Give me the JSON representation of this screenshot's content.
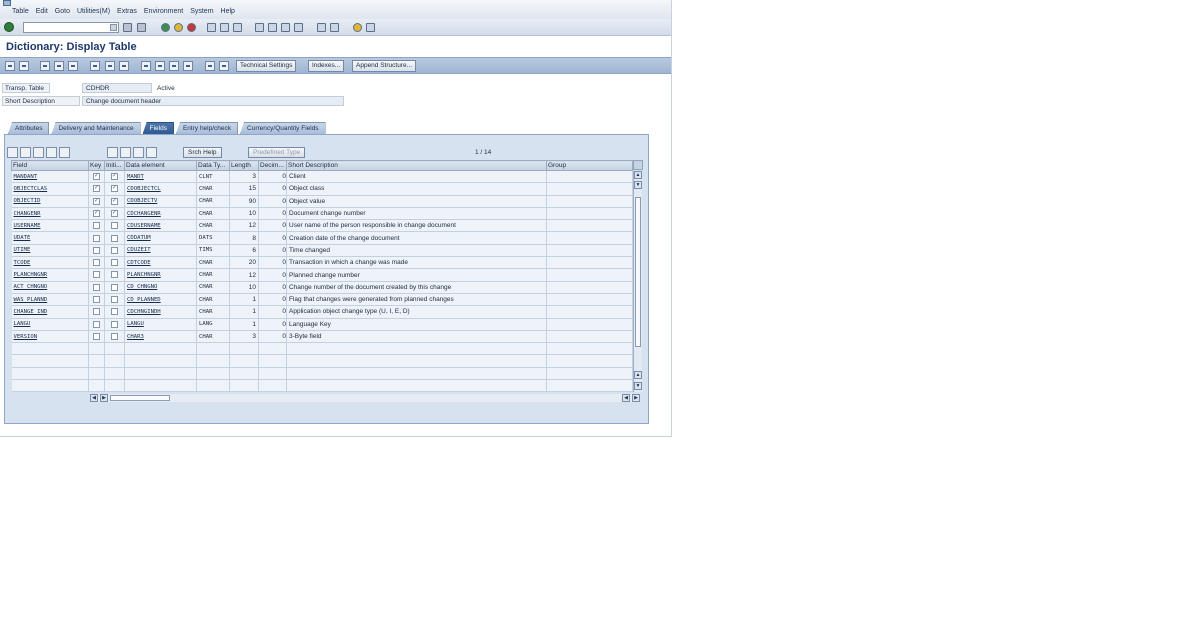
{
  "menu": {
    "items": [
      "Table",
      "Edit",
      "Goto",
      "Utilities(M)",
      "Extras",
      "Environment",
      "System",
      "Help"
    ]
  },
  "system_toolbar": {
    "command_field": ""
  },
  "title": "Dictionary: Display Table",
  "app_toolbar": {
    "technical_settings": "Technical Settings",
    "indexes": "Indexes...",
    "append_structure": "Append Structure..."
  },
  "header": {
    "table_label": "Transp. Table",
    "table_value": "CDHDR",
    "status": "Active",
    "short_desc_label": "Short Description",
    "short_desc_value": "Change document header"
  },
  "tabs": [
    {
      "label": "Attributes",
      "active": false
    },
    {
      "label": "Delivery and Maintenance",
      "active": false
    },
    {
      "label": "Fields",
      "active": true
    },
    {
      "label": "Entry help/check",
      "active": false
    },
    {
      "label": "Currency/Quantity Fields",
      "active": false
    }
  ],
  "panel_toolbar": {
    "srch_help": "Srch Help",
    "predefined_type": "Predefined Type",
    "pager": "1 / 14"
  },
  "columns": [
    "Field",
    "Key",
    "Initi...",
    "Data element",
    "Data Ty...",
    "Length",
    "Decim...",
    "Short Description",
    "Group"
  ],
  "rows": [
    {
      "field": "MANDANT",
      "key": true,
      "init": true,
      "data_element": "MANDT",
      "type": "CLNT",
      "length": "3",
      "dec": "0",
      "desc": "Client"
    },
    {
      "field": "OBJECTCLAS",
      "key": true,
      "init": true,
      "data_element": "CDOBJECTCL",
      "type": "CHAR",
      "length": "15",
      "dec": "0",
      "desc": "Object class"
    },
    {
      "field": "OBJECTID",
      "key": true,
      "init": true,
      "data_element": "CDOBJECTV",
      "type": "CHAR",
      "length": "90",
      "dec": "0",
      "desc": "Object value"
    },
    {
      "field": "CHANGENR",
      "key": true,
      "init": true,
      "data_element": "CDCHANGENR",
      "type": "CHAR",
      "length": "10",
      "dec": "0",
      "desc": "Document change number"
    },
    {
      "field": "USERNAME",
      "key": false,
      "init": false,
      "data_element": "CDUSERNAME",
      "type": "CHAR",
      "length": "12",
      "dec": "0",
      "desc": "User name of the person responsible in change document"
    },
    {
      "field": "UDATE",
      "key": false,
      "init": false,
      "data_element": "CDDATUM",
      "type": "DATS",
      "length": "8",
      "dec": "0",
      "desc": "Creation date of the change document"
    },
    {
      "field": "UTIME",
      "key": false,
      "init": false,
      "data_element": "CDUZEIT",
      "type": "TIMS",
      "length": "6",
      "dec": "0",
      "desc": "Time changed"
    },
    {
      "field": "TCODE",
      "key": false,
      "init": false,
      "data_element": "CDTCODE",
      "type": "CHAR",
      "length": "20",
      "dec": "0",
      "desc": "Transaction in which a change was made"
    },
    {
      "field": "PLANCHNGNR",
      "key": false,
      "init": false,
      "data_element": "PLANCHNGNR",
      "type": "CHAR",
      "length": "12",
      "dec": "0",
      "desc": "Planned change number"
    },
    {
      "field": "ACT_CHNGNO",
      "key": false,
      "init": false,
      "data_element": "CD_CHNGNO",
      "type": "CHAR",
      "length": "10",
      "dec": "0",
      "desc": "Change number of the document created by this change"
    },
    {
      "field": "WAS_PLANND",
      "key": false,
      "init": false,
      "data_element": "CD_PLANNED",
      "type": "CHAR",
      "length": "1",
      "dec": "0",
      "desc": "Flag that changes were generated from planned changes"
    },
    {
      "field": "CHANGE_IND",
      "key": false,
      "init": false,
      "data_element": "CDCHNGINDH",
      "type": "CHAR",
      "length": "1",
      "dec": "0",
      "desc": "Application object change type (U, I, E, D)"
    },
    {
      "field": "LANGU",
      "key": false,
      "init": false,
      "data_element": "LANGU",
      "type": "LANG",
      "length": "1",
      "dec": "0",
      "desc": "Language Key"
    },
    {
      "field": "VERSION",
      "key": false,
      "init": false,
      "data_element": "CHAR3",
      "type": "CHAR",
      "length": "3",
      "dec": "0",
      "desc": "3-Byte field"
    }
  ],
  "empty_rows": 4
}
